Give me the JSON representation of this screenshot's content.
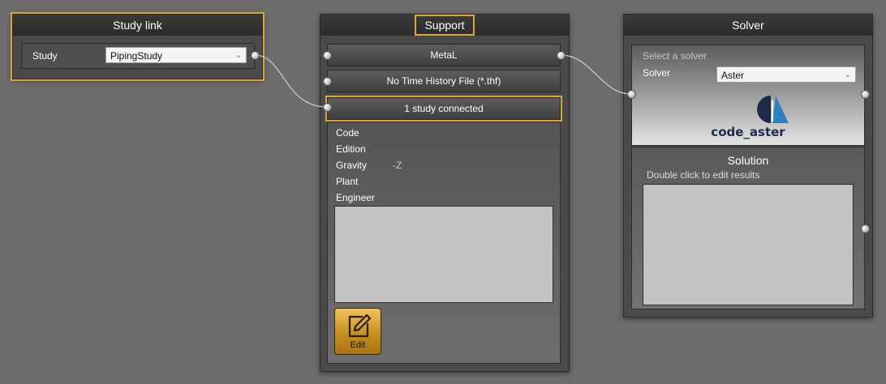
{
  "study_link": {
    "title": "Study link",
    "field_label": "Study",
    "selected": "PipingStudy"
  },
  "support": {
    "title": "Support",
    "buttons": [
      "MetaL",
      "No Time History File (*.thf)",
      "1 study connected"
    ],
    "properties": [
      {
        "label": "Code",
        "value": ""
      },
      {
        "label": "Edition",
        "value": ""
      },
      {
        "label": "Gravity",
        "value": "-Z"
      },
      {
        "label": "Plant",
        "value": ""
      },
      {
        "label": "Engineer",
        "value": ""
      }
    ],
    "edit_label": "Edit"
  },
  "solver": {
    "title": "Solver",
    "hint": "Select a solver",
    "solver_label": "Solver",
    "selected": "Aster",
    "logo_text": "code_aster",
    "solution_title": "Solution",
    "solution_hint": "Double click to edit results"
  },
  "colors": {
    "accent": "#d9a63a",
    "logo_dark": "#1f2a4a",
    "logo_blue": "#2f7fc1"
  }
}
